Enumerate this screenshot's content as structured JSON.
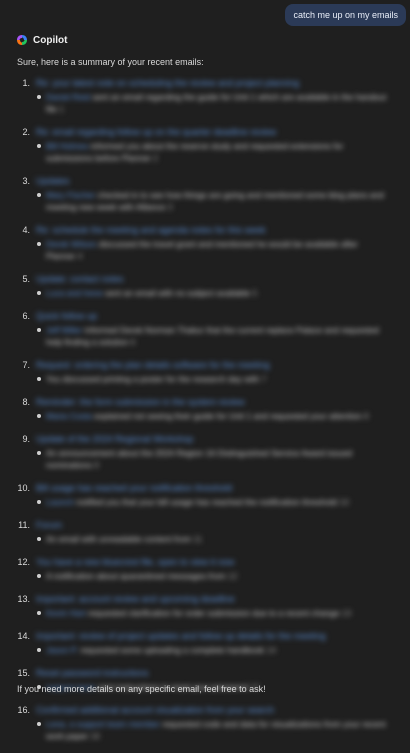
{
  "conversation": {
    "user_message": "catch me up on my emails",
    "assistant_name": "Copilot",
    "intro": "Sure, here is a summary of your recent emails:",
    "outro": "If you need more details on any specific email, feel free to ask!"
  },
  "email_summary": {
    "items": [
      {
        "num": "1.",
        "subject": "Re: your latest note on scheduling the review and project planning",
        "who": "Daniel Reid",
        "text": "sent an email regarding the guide for Unit 1 which are available in the handout file",
        "ref": "1"
      },
      {
        "num": "2.",
        "subject": "Re: email regarding follow up on the quarter deadline review",
        "who": "Bill Holmes",
        "text": "informed you about the reserve study and requested extensions for submissions before Planner",
        "ref": "2"
      },
      {
        "num": "3.",
        "subject": "Updates",
        "who": "Mary Fischer",
        "text": "checked in to see how things are going and mentioned some blog plans and meeting new week with Alliance",
        "ref": "3"
      },
      {
        "num": "4.",
        "subject": "Re: schedule the meeting and agenda notes for this week",
        "who": "Derek Wilson",
        "text": "discussed the travel grant and mentioned he would be available after Planner",
        "ref": "4"
      },
      {
        "num": "5.",
        "subject": "Update: contact notes",
        "who": "Luca and Irene",
        "text": "sent an email with no subject available",
        "ref": "5"
      },
      {
        "num": "6.",
        "subject": "Quick follow up",
        "who": "Jeff Miller",
        "text": "informed Derek Norman Thakur that the current replace Palace and requested help finding a solution",
        "ref": "6"
      },
      {
        "num": "7.",
        "subject": "Request: ordering the plan details software for the meeting",
        "who": "",
        "text": "You discussed printing a poster for the research day with",
        "ref": "7"
      },
      {
        "num": "8.",
        "subject": "Reminder: the form submission in the system review",
        "who": "Maria Costa",
        "text": "explained not seeing their guide for Unit 1 and requested your attention",
        "ref": "8"
      },
      {
        "num": "9.",
        "subject": "Update of the 2024 Regional Workshop",
        "who": "",
        "text": "An announcement about the 2024 Region 16 Distinguished Service Award issued nominations",
        "ref": "9"
      },
      {
        "num": "10.",
        "subject": "Bill usage has reached your notification threshold",
        "who": "Launch",
        "text": "notified you that your bill usage has reached the notification threshold",
        "ref": "10"
      },
      {
        "num": "11.",
        "subject": "Forum",
        "who": "",
        "text": "An email with unreadable content from",
        "ref": "11"
      },
      {
        "num": "12.",
        "subject": "You have a new bluecrest file, open to view it now",
        "who": "",
        "text": "A notification about quarantined messages from",
        "ref": "12"
      },
      {
        "num": "13.",
        "subject": "Important: account review and upcoming deadline",
        "who": "Kevin Hart",
        "text": "requested clarification for order submission due to a recent change",
        "ref": "13"
      },
      {
        "num": "14.",
        "subject": "Important: review of project updates and follow up details for the meeting",
        "who": "Jason P.",
        "text": "requested some uploading a complete handbook",
        "ref": "14"
      },
      {
        "num": "15.",
        "subject": "Reset password instructions",
        "who": "support team",
        "text": "sent instructions to reset your password",
        "ref": "15"
      },
      {
        "num": "16.",
        "subject": "Confirmed additional account visualization from your search",
        "who": "Lena, a support team member",
        "text": "requested code and data for visualizations from your recent work paper",
        "ref": "16"
      }
    ]
  },
  "colors": {
    "background": "#1f1f1f",
    "user_bubble": "#2b3a57",
    "link": "#5b8fd6",
    "text": "#d9d9d9"
  }
}
